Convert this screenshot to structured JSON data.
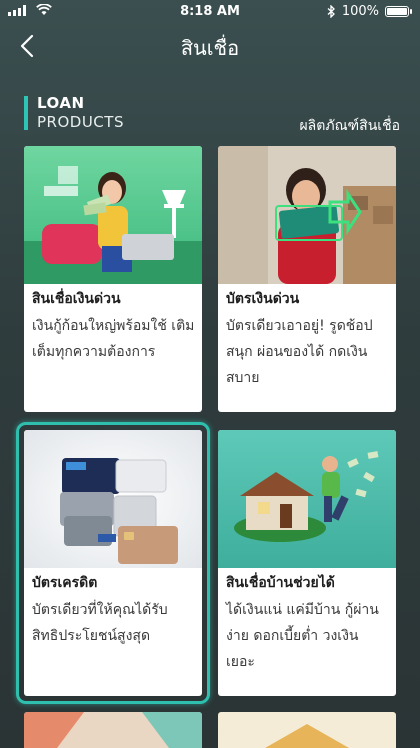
{
  "status_bar": {
    "time": "8:18 AM",
    "battery": "100%",
    "icons": [
      "signal-icon",
      "wifi-icon",
      "bluetooth-icon",
      "battery-icon"
    ]
  },
  "nav": {
    "title": "สินเชื่อ",
    "back_icon": "chevron-left-icon"
  },
  "section": {
    "title_line1": "LOAN",
    "title_line2": "PRODUCTS",
    "link_label": "ผลิตภัณฑ์สินเชื่อ",
    "accent_color": "#2ec4b6"
  },
  "cards": [
    {
      "title": "สินเชื่อเงินด่วน",
      "desc": "เงินกู้ก้อนใหญ่พร้อมใช้ เติมเต็มทุกความต้องการ"
    },
    {
      "title": "บัตรเงินด่วน",
      "desc": "บัตรเดียวเอาอยู่! รูดช้อป สนุก ผ่อนของได้ กดเงิน สบาย"
    },
    {
      "title": "บัตรเครดิต",
      "desc": "บัตรเดียวที่ให้คุณได้รับ สิทธิประโยชน์สูงสุด",
      "selected": true
    },
    {
      "title": "สินเชื่อบ้านช่วยได้",
      "desc": "ได้เงินแน่ แค่มีบ้าน กู้ผ่าน ง่าย ดอกเบี้ยต่ำ วงเงิน เยอะ"
    }
  ],
  "selection_color": "#2fbfae"
}
